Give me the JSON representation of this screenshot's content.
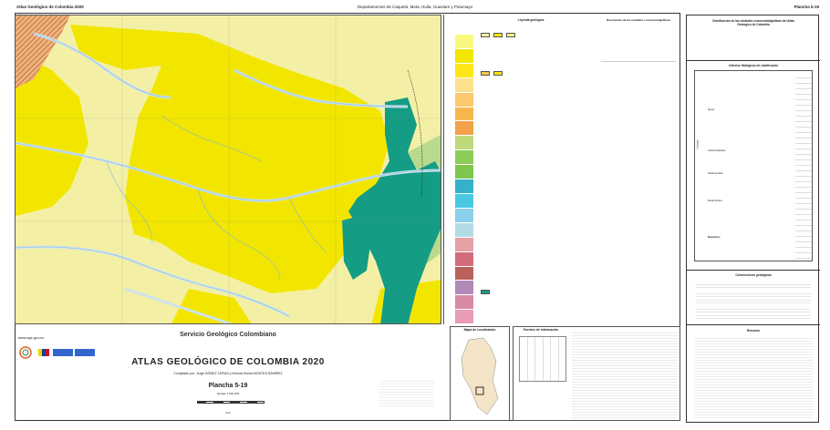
{
  "header": {
    "left": "Atlas Geológico de Colombia 2020",
    "center": "Departamentos de Caquetá, Meta, Huila, Guaviare y Putumayo",
    "right": "Plancha 5-19"
  },
  "legend": {
    "title": "Leyenda geológica",
    "desc_title": "Descripción de las unidades cronoestratigráficas"
  },
  "right_panel": {
    "title": "Clasificación de las unidades cronoestratigráficas del Atlas Geológico de Colombia",
    "litho_title": "Criterios litológicos de clasificación",
    "conv_title": "Convenciones geológicas",
    "resumen_title": "Resumen",
    "side_label": "Litología",
    "groups": [
      "Ígnea",
      "Volcanoclástica",
      "Sedimentaria",
      "Metamórfica",
      "Depósitos"
    ]
  },
  "bottom": {
    "www": "www.sgc.gov.co",
    "sgc": "Servicio Geológico Colombiano",
    "atlas": "ATLAS GEOLÓGICO DE COLOMBIA 2020",
    "compiled": "Compilado por: Jorge GÓMEZ TAPIAS y Nohora Emma MONTES RAMÍREZ",
    "plancha": "Plancha 5-19",
    "escala": "Escala: 1:500 000",
    "year": "2020"
  },
  "loc_map": {
    "title": "Mapa de Localización"
  },
  "sources": {
    "title": "Fuentes de información"
  },
  "colors": {
    "yellow": "#f2e600",
    "pale": "#f3f0a5",
    "teal": "#149c84",
    "river": "#cfe3ee",
    "green_light": "#b9d98f"
  }
}
